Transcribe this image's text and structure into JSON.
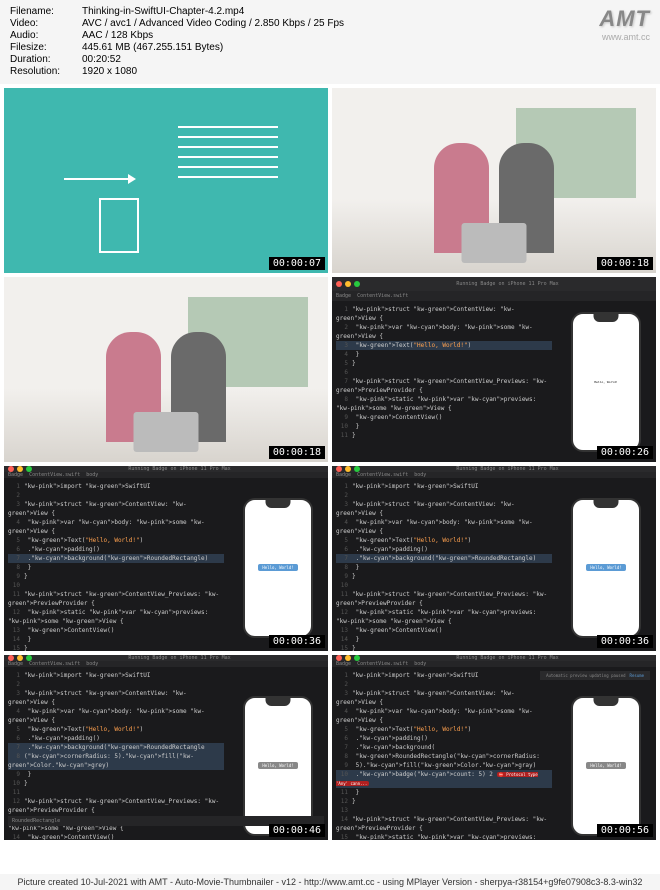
{
  "header": {
    "filename_label": "Filename:",
    "filename": "Thinking-in-SwiftUI-Chapter-4.2.mp4",
    "video_label": "Video:",
    "video": "AVC / avc1 / Advanced Video Coding / 2.850 Kbps / 25 Fps",
    "audio_label": "Audio:",
    "audio": "AAC / 128 Kbps",
    "filesize_label": "Filesize:",
    "filesize": "445.61 MB (467.255.151 Bytes)",
    "duration_label": "Duration:",
    "duration": "00:20:52",
    "resolution_label": "Resolution:",
    "resolution": "1920 x 1080"
  },
  "watermark": {
    "main": "AMT",
    "sub": "www.amt.cc"
  },
  "timestamps": [
    "00:00:07",
    "00:00:18",
    "00:00:18",
    "00:00:26",
    "00:00:36",
    "00:00:36",
    "00:00:46",
    "00:00:56"
  ],
  "xcode": {
    "status": "Running Badge on iPhone 11 Pro Max",
    "tabs": [
      "Badge",
      "ContentView.swift",
      "body"
    ],
    "phone_text": "Hello, World!",
    "badge_text": "Hello, World!",
    "bottom_bar": "RoundedRectangle",
    "preview_banner": "Automatic preview updating paused",
    "resume": "Resume",
    "error_text": "Protocol type 'Any' cann..."
  },
  "code": {
    "c1": [
      "struct ContentView: View {",
      "  var body: some View {",
      "    Text(\"Hello, World!\")",
      "  }",
      "}",
      "",
      "struct ContentView_Previews: PreviewProvider {",
      "  static var previews: some View {",
      "    ContentView()",
      "  }",
      "}"
    ],
    "c2": [
      "import SwiftUI",
      "",
      "struct ContentView: View {",
      "  var body: some View {",
      "    Text(\"Hello, World!\")",
      "      .padding()",
      "      .background(RoundedRectangle)",
      "  }",
      "}",
      "",
      "struct ContentView_Previews: PreviewProvider {",
      "  static var previews: some View {",
      "    ContentView()",
      "  }",
      "}"
    ],
    "c3": [
      "import SwiftUI",
      "",
      "struct ContentView: View {",
      "  var body: some View {",
      "    Text(\"Hello, World!\")",
      "      .padding()",
      "      .background(RoundedRectangle",
      "(cornerRadius: 5).fill(Color.grey)",
      "  }",
      "}",
      "",
      "struct ContentView_Previews: PreviewProvider {",
      "  static var previews: some View {",
      "    ContentView()",
      "  }",
      "}"
    ],
    "c4": [
      "import SwiftUI",
      "",
      "struct ContentView: View {",
      "  var body: some View {",
      "    Text(\"Hello, World!\")",
      "      .padding()",
      "      .background(",
      "        RoundedRectangle(cornerRadius:",
      "          5).fill(Color.gray)",
      "      .badge(count: 5)  2",
      "  }",
      "}",
      "",
      "struct ContentView_Previews: PreviewProvider {",
      "  static var previews: some View {",
      "    ContentView()"
    ]
  },
  "footer": "Picture created 10-Jul-2021 with AMT - Auto-Movie-Thumbnailer - v12 - http://www.amt.cc - using MPlayer Version - sherpya-r38154+g9fe07908c3-8.3-win32"
}
